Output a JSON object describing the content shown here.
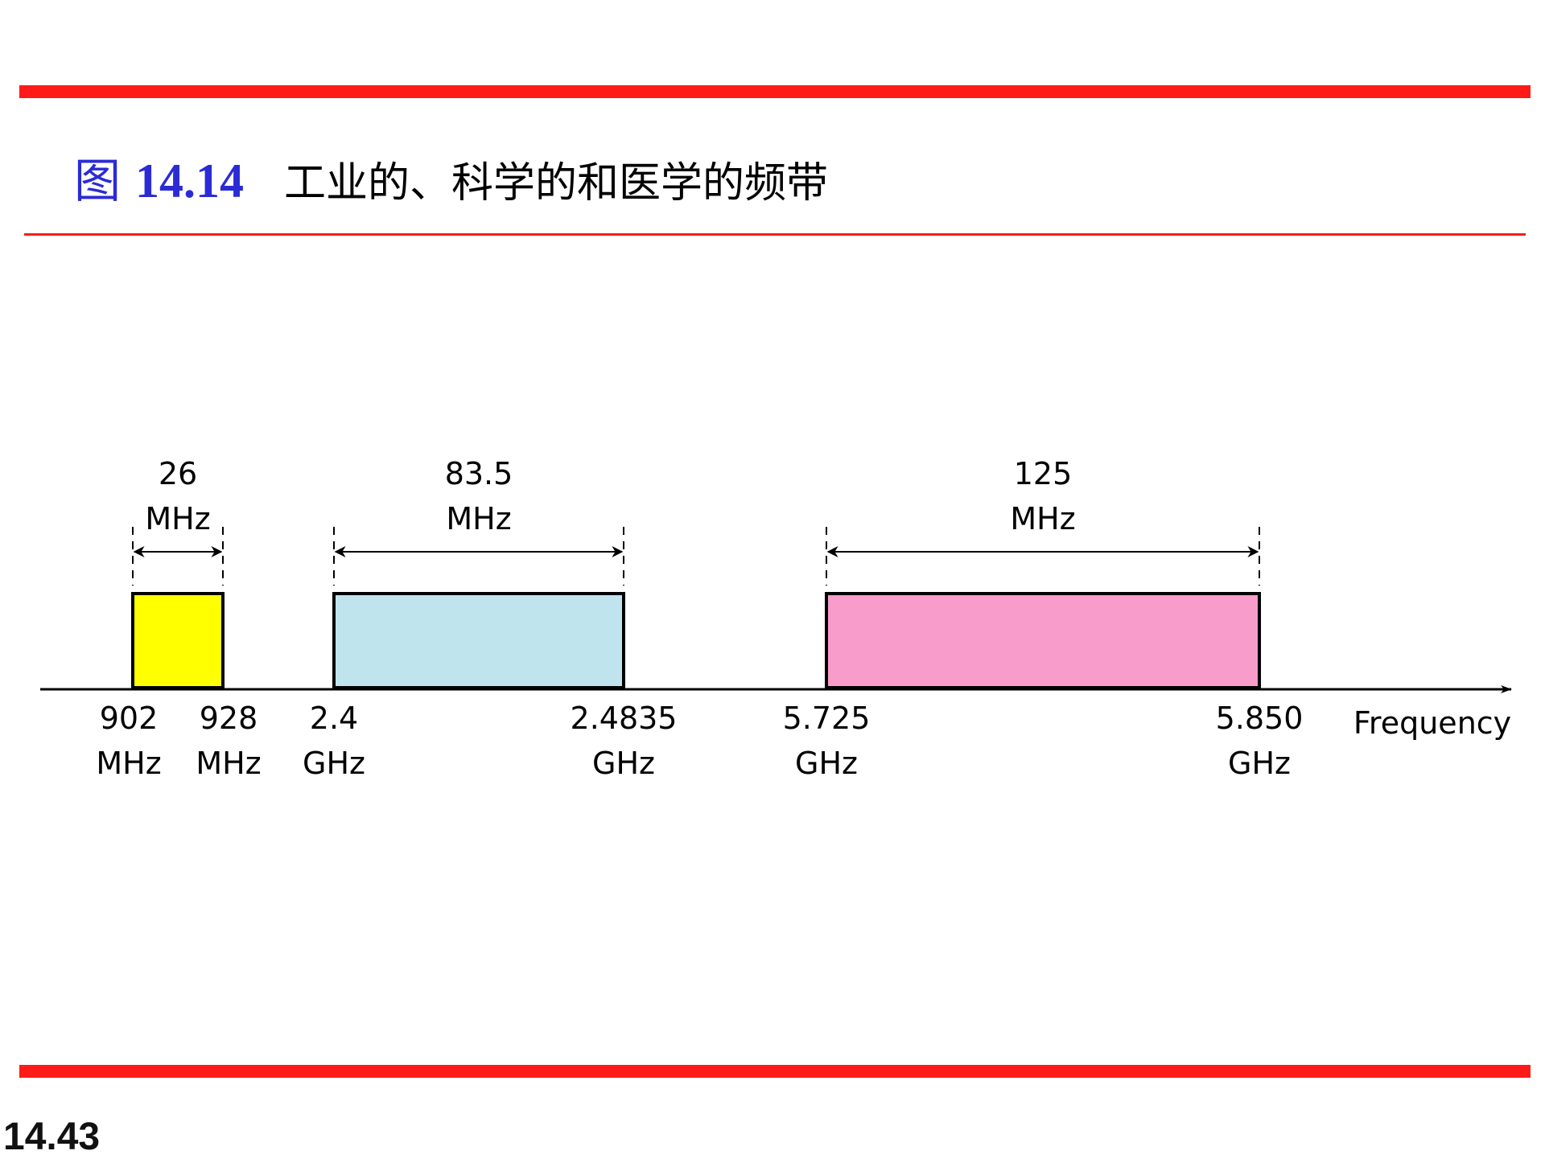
{
  "figure": {
    "label": "图",
    "number": "14.14",
    "caption": "工业的、科学的和医学的频带"
  },
  "diagram": {
    "axis_label": "Frequency",
    "bands": [
      {
        "width_label": [
          "26",
          "MHz"
        ],
        "start_label": [
          "902",
          "MHz"
        ],
        "end_label": [
          "928",
          "MHz"
        ],
        "fill": "#ffff00"
      },
      {
        "width_label": [
          "83.5",
          "MHz"
        ],
        "start_label": [
          "2.4",
          "GHz"
        ],
        "end_label": [
          "2.4835",
          "GHz"
        ],
        "fill": "#bfe4ee"
      },
      {
        "width_label": [
          "125",
          "MHz"
        ],
        "start_label": [
          "5.725",
          "GHz"
        ],
        "end_label": [
          "5.850",
          "GHz"
        ],
        "fill": "#f79ccb"
      }
    ]
  },
  "page_number": "14.43"
}
